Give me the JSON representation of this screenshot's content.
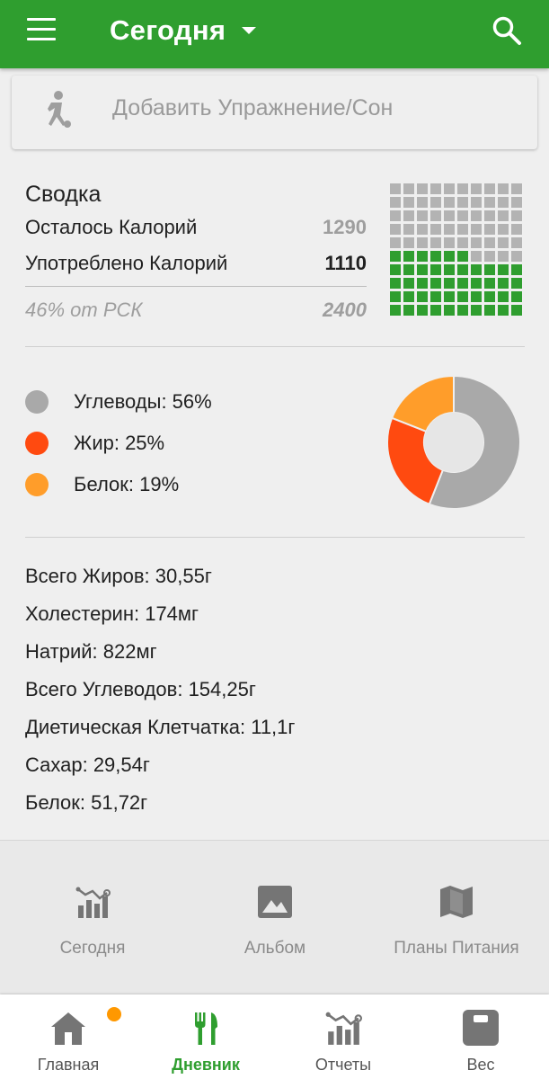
{
  "header": {
    "title": "Сегодня",
    "accent_color": "#2f9e2f",
    "icons": {
      "menu": "menu-icon",
      "dropdown": "caret-down-icon",
      "search": "search-icon"
    }
  },
  "add_card": {
    "label": "Добавить Упражнение/Сон",
    "icon": "exercise-icon"
  },
  "summary": {
    "title": "Сводка",
    "remaining_label": "Осталось Калорий",
    "remaining_value": "1290",
    "consumed_label": "Употреблено Калорий",
    "consumed_value": "1110",
    "rsk_label": "46% от РСК",
    "rsk_value": "2400",
    "grid": {
      "cells_total": 100,
      "cells_filled": 46,
      "filled_color": "#2f9e2f",
      "empty_color": "#b3b3b3"
    }
  },
  "macros": [
    {
      "label": "Углеводы: 56%",
      "percent": 56,
      "color": "#a9a9a9"
    },
    {
      "label": "Жир: 25%",
      "percent": 25,
      "color": "#ff4a10"
    },
    {
      "label": "Белок: 19%",
      "percent": 19,
      "color": "#ff9d2a"
    }
  ],
  "nutrients": [
    "Всего Жиров: 30,55г",
    "Холестерин: 174мг",
    "Натрий: 822мг",
    "Всего Углеводов: 154,25г",
    "Диетическая Клетчатка: 11,1г",
    "Сахар: 29,54г",
    "Белок: 51,72г"
  ],
  "quick_actions": [
    {
      "label": "Сегодня",
      "icon": "chart-trend-icon"
    },
    {
      "label": "Альбом",
      "icon": "image-icon"
    },
    {
      "label": "Планы Питания",
      "icon": "map-icon"
    }
  ],
  "bottom_nav": [
    {
      "label": "Главная",
      "icon": "home-icon",
      "badge": true
    },
    {
      "label": "Дневник",
      "icon": "fork-knife-icon",
      "active": true
    },
    {
      "label": "Отчеты",
      "icon": "reports-icon"
    },
    {
      "label": "Вес",
      "icon": "scale-icon"
    }
  ]
}
